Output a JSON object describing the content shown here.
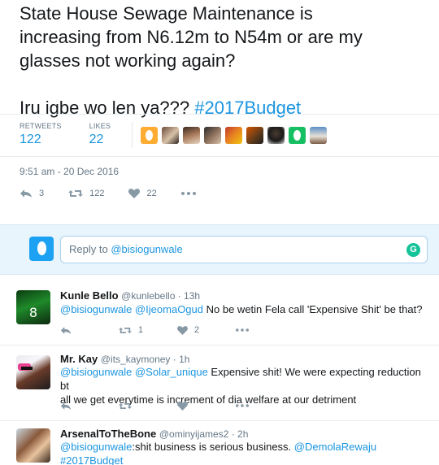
{
  "tweet": {
    "text_lines": [
      "State House Sewage Maintenance is",
      "increasing from N6.12m to N54m or are my",
      "glasses not working again?"
    ],
    "text_line4_plain": "Iru igbe wo len ya??? ",
    "text_line4_hashtag": "#2017Budget",
    "retweets_label": "RETWEETS",
    "retweets_count": "122",
    "likes_label": "LIKES",
    "likes_count": "22",
    "timestamp": "9:51 am - 20 Dec 2016",
    "actions": {
      "reply_count": "3",
      "retweet_count": "122",
      "like_count": "22"
    }
  },
  "reply_box": {
    "placeholder_prefix": "Reply to ",
    "placeholder_mention": "@bisiogunwale",
    "grammarly_label": "G"
  },
  "replies": [
    {
      "name": "Kunle Bello",
      "handle": "@kunlebello",
      "time": " · 13h",
      "mention1": "@bisiogunwale",
      "mention2": "@IjeomaOgud",
      "text": " No be wetin Fela call 'Expensive Shit' be that?",
      "retweets": "1",
      "likes": "2"
    },
    {
      "name": "Mr. Kay",
      "handle": "@its_kaymoney",
      "time": " · 1h",
      "mention1": "@bisiogunwale",
      "mention2": "@Solar_unique",
      "text_line1": " Expensive shit! We were expecting reduction bt",
      "text_line2": "all we get everytime is increment of dia welfare at our detriment"
    },
    {
      "name": "ArsenalToTheBone",
      "handle": "@ominyijames2",
      "time": " · 2h",
      "mention1": "@bisiogunwale",
      "text": ":shit business is serious business. ",
      "mention2": "@DemolaRewaju",
      "hashtag": "#2017Budget"
    }
  ],
  "colors": {
    "accent": "#1b95e0",
    "muted": "#657786",
    "reply_bg": "#e8f5fd"
  }
}
